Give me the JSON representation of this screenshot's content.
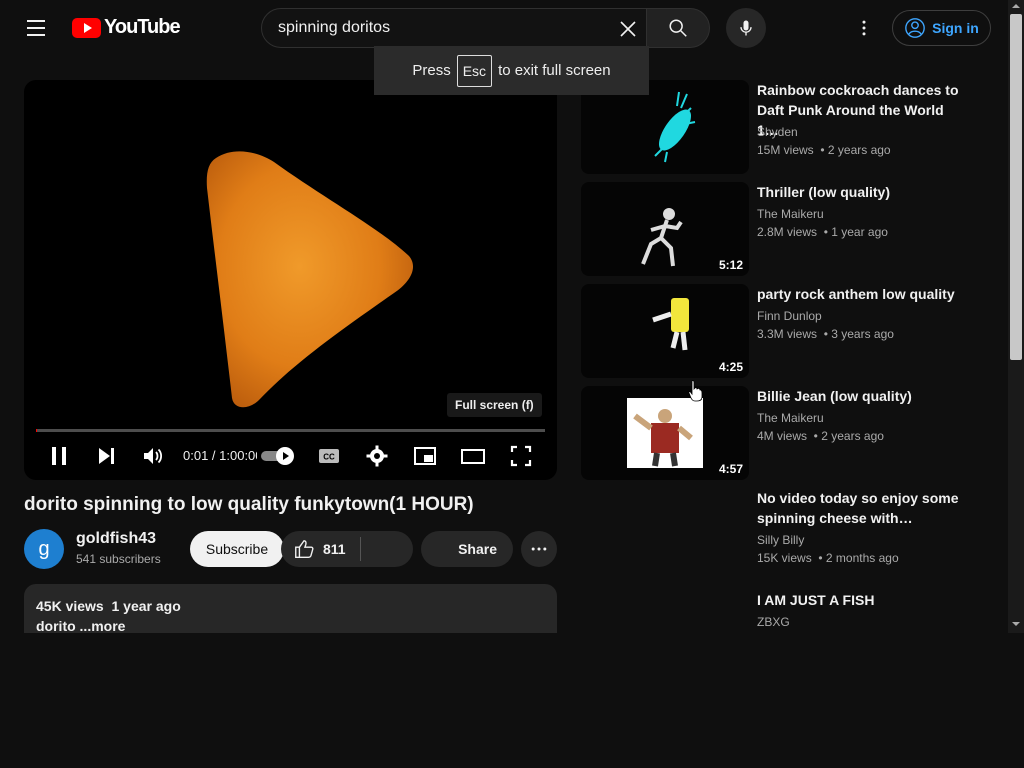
{
  "header": {
    "logo_text": "YouTube",
    "search_value": "spinning doritos",
    "sign_in_label": "Sign in"
  },
  "fullscreen_toast": {
    "press": "Press",
    "key": "Esc",
    "message": "to exit full screen"
  },
  "player": {
    "tooltip": "Full screen (f)",
    "time": "0:01 / 1:00:00",
    "progress": 0.0003
  },
  "video": {
    "title": "dorito spinning to low quality funkytown(1 HOUR)",
    "channel": "goldfish43",
    "avatar_letter": "g",
    "subscribers": "541 subscribers",
    "subscribe_label": "Subscribe",
    "likes": "811",
    "share_label": "Share",
    "views": "45K views",
    "uploaded": "1 year ago",
    "description": "dorito",
    "more_label": "...more"
  },
  "recommendations": [
    {
      "title": "Rainbow cockroach dances to Daft Punk Around the World 1…",
      "channel": "Shyden",
      "views": "15M views",
      "age": "2 years ago",
      "duration": "",
      "thumb_icon": "cockroach-icon"
    },
    {
      "title": "Thriller (low quality)",
      "channel": "The Maikeru",
      "views": "2.8M views",
      "age": "1 year ago",
      "duration": "5:12",
      "thumb_icon": "skeleton-dancer-icon"
    },
    {
      "title": "party rock anthem low quality",
      "channel": "Finn Dunlop",
      "views": "3.3M views",
      "age": "3 years ago",
      "duration": "4:25",
      "thumb_icon": "sponge-dancer-icon"
    },
    {
      "title": "Billie Jean (low quality)",
      "channel": "The Maikeru",
      "views": "4M views",
      "age": "2 years ago",
      "duration": "4:57",
      "thumb_icon": "heavy-character-icon"
    },
    {
      "title": "No video today so enjoy some spinning cheese with…",
      "channel": "Silly Billy",
      "views": "15K views",
      "age": "2 months ago",
      "duration": "",
      "thumb_icon": ""
    },
    {
      "title": "I AM JUST A FISH",
      "channel": "ZBXG",
      "views": "",
      "age": "",
      "duration": "",
      "thumb_icon": ""
    }
  ],
  "colors": {
    "background": "#0f0f0f",
    "accent_red": "#ff0000",
    "link_blue": "#3ea6ff"
  }
}
